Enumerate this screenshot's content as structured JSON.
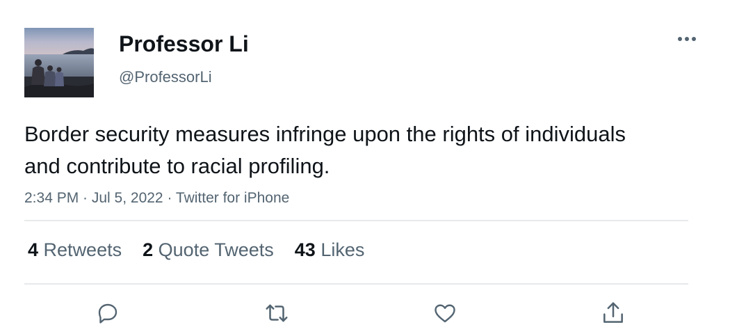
{
  "author": {
    "name": "Professor Li",
    "handle": "@ProfessorLi"
  },
  "tweet": {
    "text": "Border security measures infringe upon the rights of individuals and contribute to racial profiling.",
    "meta": "2:34 PM · Jul 5, 2022 · Twitter for iPhone"
  },
  "stats": {
    "retweets_count": "4",
    "retweets_label": "Retweets",
    "quotes_count": "2",
    "quotes_label": "Quote Tweets",
    "likes_count": "43",
    "likes_label": "Likes"
  },
  "icons": {
    "more": "more-horizontal-icon",
    "reply": "reply-icon",
    "retweet": "retweet-icon",
    "like": "heart-icon",
    "share": "share-icon"
  },
  "colors": {
    "text_primary": "#0f1419",
    "text_secondary": "#536471",
    "divider": "#e7e9ea"
  }
}
